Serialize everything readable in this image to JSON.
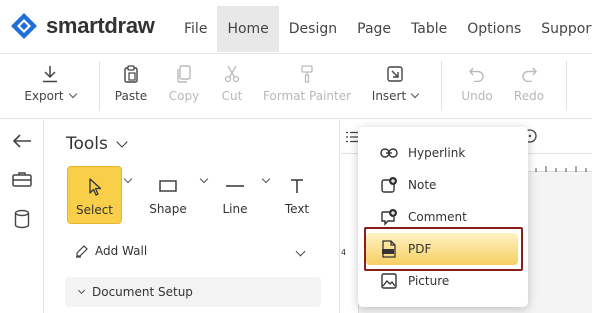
{
  "app": {
    "logo_text": "smartdraw"
  },
  "menu": [
    "File",
    "Home",
    "Design",
    "Page",
    "Table",
    "Options",
    "Support"
  ],
  "menu_active": "Home",
  "ribbon": {
    "export": "Export",
    "paste": "Paste",
    "copy": "Copy",
    "cut": "Cut",
    "format_painter": "Format Painter",
    "insert": "Insert",
    "undo": "Undo",
    "redo": "Redo"
  },
  "tools_panel": {
    "title": "Tools",
    "tools": [
      {
        "label": "Select",
        "icon": "cursor-icon",
        "selected": true
      },
      {
        "label": "Shape",
        "icon": "rectangle-icon"
      },
      {
        "label": "Line",
        "icon": "line-icon"
      },
      {
        "label": "Text",
        "icon": "text-icon"
      }
    ],
    "add_wall": "Add Wall",
    "document_setup": "Document Setup"
  },
  "canvas": {
    "ruler_number": "4"
  },
  "insert_menu": {
    "items": [
      {
        "label": "Hyperlink",
        "icon": "link-icon"
      },
      {
        "label": "Note",
        "icon": "note-icon"
      },
      {
        "label": "Comment",
        "icon": "comment-icon"
      },
      {
        "label": "PDF",
        "icon": "pdf-icon",
        "highlighted": true
      },
      {
        "label": "Picture",
        "icon": "picture-icon"
      }
    ]
  },
  "colors": {
    "selected_tool": "#f9cf4a",
    "highlight_outline": "#8b1d1d",
    "logo_blue": "#1f6fd8"
  }
}
